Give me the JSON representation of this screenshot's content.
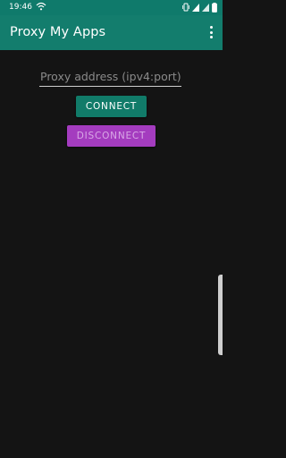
{
  "status_bar": {
    "time": "19:46",
    "icons": [
      "wifi-icon",
      "vibrate-icon",
      "signal-icon",
      "signal-icon",
      "battery-icon"
    ]
  },
  "app_bar": {
    "title": "Proxy My Apps",
    "menu_icon": "overflow-menu-icon"
  },
  "form": {
    "proxy_placeholder": "Proxy address (ipv4:port)",
    "proxy_value": "",
    "connect_label": "CONNECT",
    "disconnect_label": "DISCONNECT"
  },
  "colors": {
    "primary": "#137d6d",
    "status_bar": "#0f7a6b",
    "background": "#141414",
    "connect_button": "#117b69",
    "disconnect_button": "#a43cbf",
    "disconnect_text": "#d9a8e6"
  }
}
